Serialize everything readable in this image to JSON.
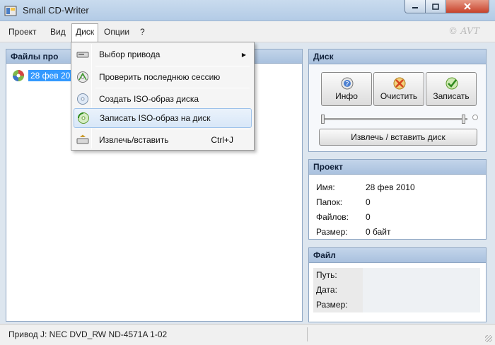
{
  "window": {
    "title": "Small CD-Writer"
  },
  "menubar": {
    "items": [
      "Проект",
      "Вид",
      "Диск",
      "Опции",
      "?"
    ],
    "brand": "© AVT"
  },
  "disk_menu": {
    "items": [
      {
        "label": "Выбор привода",
        "accel": "",
        "submenu": true,
        "icon": "drive-icon"
      },
      {
        "label": "Проверить последнюю сессию",
        "accel": "",
        "submenu": false,
        "icon": "check-session-icon"
      },
      {
        "label": "Создать ISO-образ диска",
        "accel": "",
        "submenu": false,
        "icon": "iso-create-icon"
      },
      {
        "label": "Записать ISO-образ на диск",
        "accel": "",
        "submenu": false,
        "icon": "iso-burn-icon",
        "highlighted": true
      },
      {
        "label": "Извлечь/вставить",
        "accel": "Ctrl+J",
        "submenu": false,
        "icon": "eject-icon"
      }
    ]
  },
  "files_panel": {
    "header": "Файлы про",
    "items": [
      {
        "label": "28 фев 20",
        "selected": true
      }
    ]
  },
  "disk_group": {
    "header": "Диск",
    "buttons": {
      "info": "Инфо",
      "clear": "Очистить",
      "write": "Записать"
    },
    "eject": "Извлечь / вставить диск"
  },
  "project_group": {
    "header": "Проект",
    "rows": [
      {
        "key": "Имя:",
        "value": "28 фев 2010"
      },
      {
        "key": "Папок:",
        "value": "0"
      },
      {
        "key": "Файлов:",
        "value": "0"
      },
      {
        "key": "Размер:",
        "value": "0 байт"
      }
    ]
  },
  "file_group": {
    "header": "Файл",
    "rows": [
      {
        "key": "Путь:",
        "value": ""
      },
      {
        "key": "Дата:",
        "value": ""
      },
      {
        "key": "Размер:",
        "value": ""
      }
    ]
  },
  "statusbar": {
    "text": "Привод  J:  NEC DVD_RW ND-4571A 1-02"
  },
  "colors": {
    "accent": "#3399ff",
    "panel_header": "#b3cbe6",
    "close_button": "#c8422b"
  }
}
